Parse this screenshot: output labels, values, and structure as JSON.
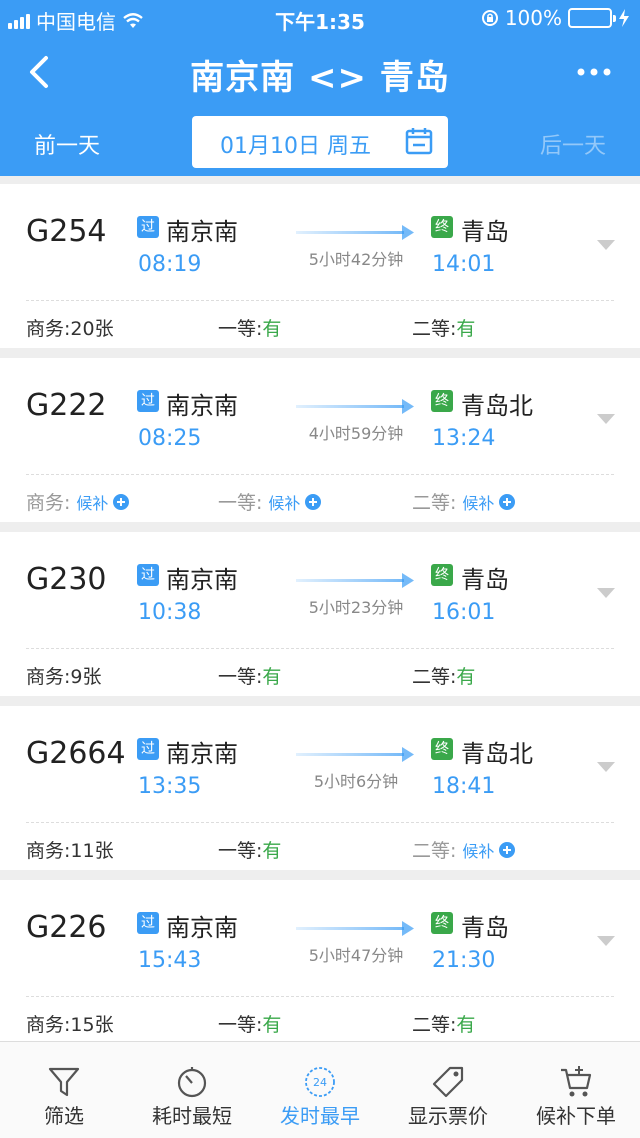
{
  "status_bar": {
    "carrier": "中国电信",
    "time": "下午1:35",
    "battery_percent": "100%",
    "battery_level": 1.0
  },
  "nav": {
    "title": "南京南 <> 青岛"
  },
  "date_bar": {
    "prev_label": "前一天",
    "date_label": "01月10日 周五",
    "next_label": "后一天"
  },
  "trains": [
    {
      "number": "G254",
      "from_tag": "过",
      "from": "南京南",
      "depart": "08:19",
      "duration": "5小时42分钟",
      "to_tag": "终",
      "to": "青岛",
      "arrive": "14:01",
      "seats": [
        {
          "label": "商务:",
          "value": "20张",
          "kind": "count"
        },
        {
          "label": "一等:",
          "value": "有",
          "kind": "avail"
        },
        {
          "label": "二等:",
          "value": "有",
          "kind": "avail"
        }
      ]
    },
    {
      "number": "G222",
      "from_tag": "过",
      "from": "南京南",
      "depart": "08:25",
      "duration": "4小时59分钟",
      "to_tag": "终",
      "to": "青岛北",
      "arrive": "13:24",
      "seats": [
        {
          "label": "商务:",
          "value": "候补",
          "kind": "wait"
        },
        {
          "label": "一等:",
          "value": "候补",
          "kind": "wait"
        },
        {
          "label": "二等:",
          "value": "候补",
          "kind": "wait"
        }
      ]
    },
    {
      "number": "G230",
      "from_tag": "过",
      "from": "南京南",
      "depart": "10:38",
      "duration": "5小时23分钟",
      "to_tag": "终",
      "to": "青岛",
      "arrive": "16:01",
      "seats": [
        {
          "label": "商务:",
          "value": "9张",
          "kind": "count"
        },
        {
          "label": "一等:",
          "value": "有",
          "kind": "avail"
        },
        {
          "label": "二等:",
          "value": "有",
          "kind": "avail"
        }
      ]
    },
    {
      "number": "G2664",
      "from_tag": "过",
      "from": "南京南",
      "depart": "13:35",
      "duration": "5小时6分钟",
      "to_tag": "终",
      "to": "青岛北",
      "arrive": "18:41",
      "seats": [
        {
          "label": "商务:",
          "value": "11张",
          "kind": "count"
        },
        {
          "label": "一等:",
          "value": "有",
          "kind": "avail"
        },
        {
          "label": "二等:",
          "value": "候补",
          "kind": "wait"
        }
      ]
    },
    {
      "number": "G226",
      "from_tag": "过",
      "from": "南京南",
      "depart": "15:43",
      "duration": "5小时47分钟",
      "to_tag": "终",
      "to": "青岛",
      "arrive": "21:30",
      "seats": [
        {
          "label": "商务:",
          "value": "15张",
          "kind": "count"
        },
        {
          "label": "一等:",
          "value": "有",
          "kind": "avail"
        },
        {
          "label": "二等:",
          "value": "有",
          "kind": "avail"
        }
      ]
    }
  ],
  "tabbar": {
    "filter": "筛选",
    "shortest": "耗时最短",
    "earliest": "发时最早",
    "earliest_badge": "24",
    "show_price": "显示票价",
    "waitlist_order": "候补下单"
  },
  "colors": {
    "primary_blue": "#3b9cf5",
    "green": "#3aa84a",
    "background": "#eeeeee"
  },
  "icons": [
    "back-icon",
    "more-icon",
    "calendar-icon",
    "wifi-icon",
    "battery-icon",
    "chevron-down-icon",
    "plus-icon",
    "filter-icon",
    "stopwatch-icon",
    "clock-24-icon",
    "price-tag-icon",
    "cart-icon"
  ]
}
